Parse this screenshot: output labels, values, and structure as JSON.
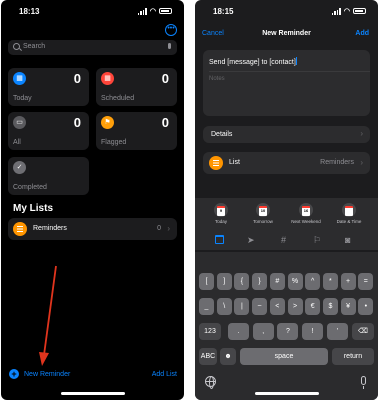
{
  "left": {
    "status": {
      "time": "18:13"
    },
    "search": {
      "placeholder": "Search"
    },
    "cards": [
      {
        "label": "Today",
        "count": "0",
        "icon": "calendar-icon",
        "color": "#0a84ff"
      },
      {
        "label": "Scheduled",
        "count": "0",
        "icon": "calendar-clock-icon",
        "color": "#ff453a"
      },
      {
        "label": "All",
        "count": "0",
        "icon": "tray-icon",
        "color": "#5a5a5e"
      },
      {
        "label": "Flagged",
        "count": "0",
        "icon": "flag-icon",
        "color": "#ff9f0a"
      },
      {
        "label": "Completed",
        "icon": "checkmark-icon",
        "color": "#6e6e73"
      }
    ],
    "my_lists_title": "My Lists",
    "lists": [
      {
        "name": "Reminders",
        "count": "0"
      }
    ],
    "new_reminder": "New Reminder",
    "add_list": "Add List",
    "annotation_color": "#e0341d"
  },
  "right": {
    "status": {
      "time": "18:15"
    },
    "nav": {
      "cancel": "Cancel",
      "title": "New Reminder",
      "add": "Add"
    },
    "title_value": "Send [message] to [contact]",
    "notes_placeholder": "Notes",
    "details_label": "Details",
    "list_label": "List",
    "list_value": "Reminders",
    "quick_dates": [
      {
        "day": "9",
        "label": "Today"
      },
      {
        "day": "10",
        "label": "Tomorrow"
      },
      {
        "day": "16",
        "label": "Next Weekend"
      },
      {
        "day": "",
        "label": "Date & Time"
      }
    ],
    "toolbar_icons": [
      "calendar-icon",
      "location-icon",
      "hashtag-icon",
      "flag-icon",
      "camera-icon"
    ],
    "keyboard": {
      "row1": [
        "[",
        "]",
        "{",
        "}",
        "#",
        "%",
        "^",
        "*",
        "+",
        "="
      ],
      "row2": [
        "_",
        "\\",
        "|",
        "~",
        "<",
        ">",
        "€",
        "$",
        "¥",
        "•"
      ],
      "row3_left": "123",
      "row3": [
        ".",
        ",",
        "?",
        "!",
        "'"
      ],
      "abc": "ABC",
      "space": "space",
      "return": "return"
    }
  }
}
